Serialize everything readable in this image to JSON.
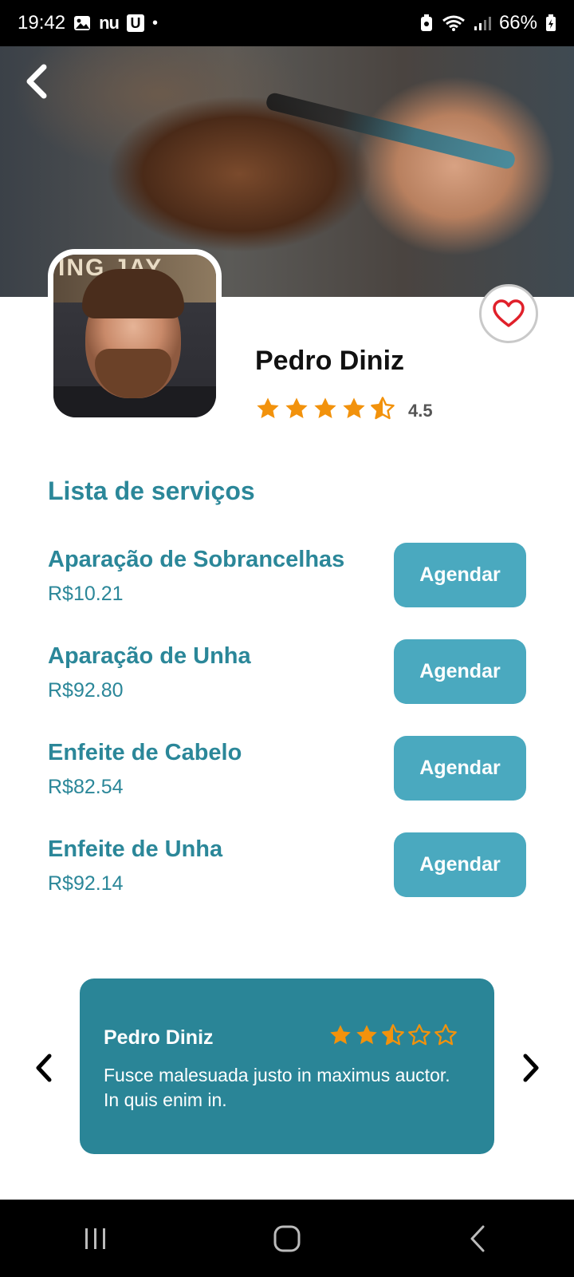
{
  "status_bar": {
    "time": "19:42",
    "app_nu": "nu",
    "app_u": "U",
    "notification_dot": "•",
    "battery": "66%"
  },
  "profile": {
    "name": "Pedro Diniz",
    "rating": "4.5",
    "stars": [
      1,
      1,
      1,
      1,
      0.5
    ],
    "avatar_banner_text": "ING JAY"
  },
  "services": {
    "title": "Lista de serviços",
    "items": [
      {
        "name": "Aparação de Sobrancelhas",
        "price": "R$10.21",
        "button": "Agendar"
      },
      {
        "name": "Aparação de Unha",
        "price": "R$92.80",
        "button": "Agendar"
      },
      {
        "name": "Enfeite de Cabelo",
        "price": "R$82.54",
        "button": "Agendar"
      },
      {
        "name": "Enfeite de Unha",
        "price": "R$92.14",
        "button": "Agendar"
      }
    ]
  },
  "review": {
    "author": "Pedro Diniz",
    "stars": [
      1,
      1,
      0.5,
      0,
      0
    ],
    "text": "Fusce malesuada justo in maximus auctor. In quis enim in."
  },
  "colors": {
    "accent": "#2b8799",
    "button": "#4aa9bf",
    "review_card": "#2a8597",
    "star": "#f2920c",
    "heart": "#e0202a"
  },
  "icons": {
    "back": "chevron-left-icon",
    "favorite": "heart-icon",
    "carousel_prev": "chevron-left-icon",
    "carousel_next": "chevron-right-icon",
    "nav_recents": "recents-icon",
    "nav_home": "home-icon",
    "nav_back": "back-icon"
  }
}
